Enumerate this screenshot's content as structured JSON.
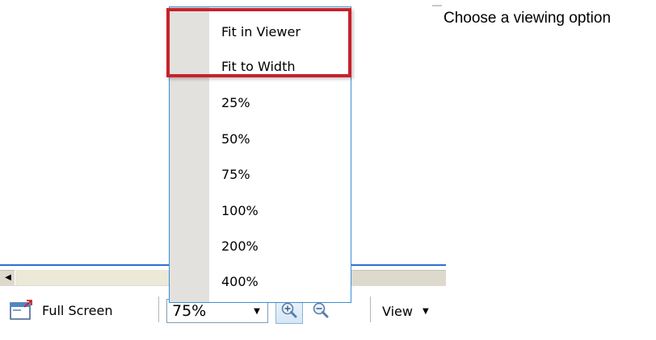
{
  "annotation": {
    "text": "Choose a viewing option"
  },
  "dropdown": {
    "items": [
      {
        "label": "Fit in Viewer"
      },
      {
        "label": "Fit to Width"
      },
      {
        "label": "25%"
      },
      {
        "label": "50%"
      },
      {
        "label": "75%"
      },
      {
        "label": "100%"
      },
      {
        "label": "200%"
      },
      {
        "label": "400%"
      }
    ],
    "highlighted_items": [
      "Fit in Viewer",
      "Fit to Width"
    ],
    "highlight_color": "#c8212b",
    "border_color": "#3a8fd6"
  },
  "toolbar": {
    "fullscreen_label": "Full Screen",
    "fullscreen_icon": "fullscreen-icon",
    "zoom_value": "75%",
    "zoom_in_icon": "zoom-in-icon",
    "zoom_out_icon": "zoom-out-icon",
    "view_label": "View"
  },
  "scrollbar": {
    "accent_line_color": "#2e6fd1"
  }
}
